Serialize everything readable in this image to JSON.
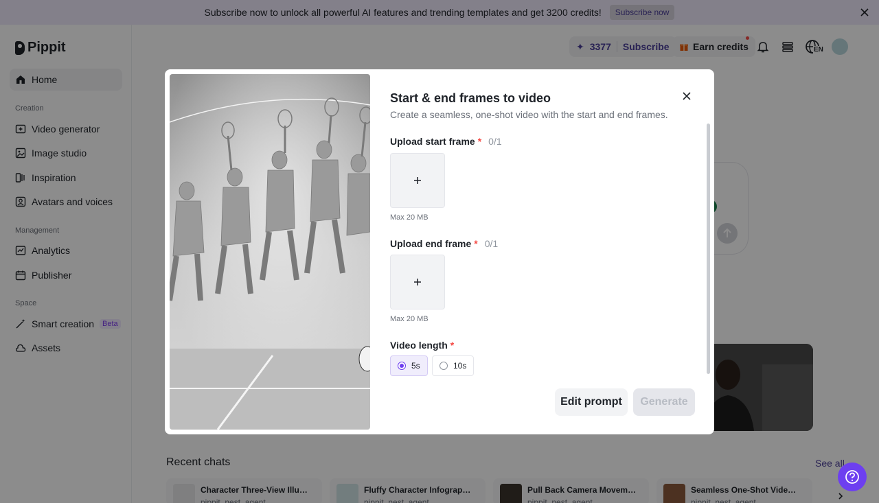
{
  "banner": {
    "text": "Subscribe now to unlock all powerful AI features and trending templates and get 3200 credits!",
    "button": "Subscribe now"
  },
  "sidebar": {
    "logo": "Pippit",
    "home": "Home",
    "sections": {
      "creation": "Creation",
      "management": "Management",
      "space": "Space"
    },
    "creation_items": [
      "Video generator",
      "Image studio",
      "Inspiration",
      "Avatars and voices"
    ],
    "management_items": [
      "Analytics",
      "Publisher"
    ],
    "space_items": [
      "Smart creation",
      "Assets"
    ],
    "beta": "Beta"
  },
  "header": {
    "credits": "3377",
    "subscribe": "Subscribe",
    "earn_credits": "Earn credits",
    "language": "EN"
  },
  "modal": {
    "title": "Start & end frames to video",
    "subtitle": "Create a seamless, one-shot video with the start and end frames.",
    "start_frame_label": "Upload start frame",
    "start_frame_count": "0/1",
    "end_frame_label": "Upload end frame",
    "end_frame_count": "0/1",
    "max_size": "Max 20 MB",
    "required_mark": "*",
    "video_length_label": "Video length",
    "options": [
      "5s",
      "10s"
    ],
    "selected_option": "5s",
    "edit_prompt": "Edit prompt",
    "generate": "Generate"
  },
  "recent": {
    "title": "Recent chats",
    "see_all": "See all",
    "chats": [
      {
        "title": "Character Three-View Illustra...",
        "sub": "pippit_nest_agent"
      },
      {
        "title": "Fluffy Character Infographic ...",
        "sub": "pippit_nest_agent"
      },
      {
        "title": "Pull Back Camera Movement ...",
        "sub": "pippit_nest_agent"
      },
      {
        "title": "Seamless One-Shot Video G...",
        "sub": "pippit_nest_agent"
      }
    ]
  },
  "colors": {
    "accent": "#6d3ff0",
    "brand_text": "#4b3f99",
    "banner_bg": "#efe9fb"
  }
}
